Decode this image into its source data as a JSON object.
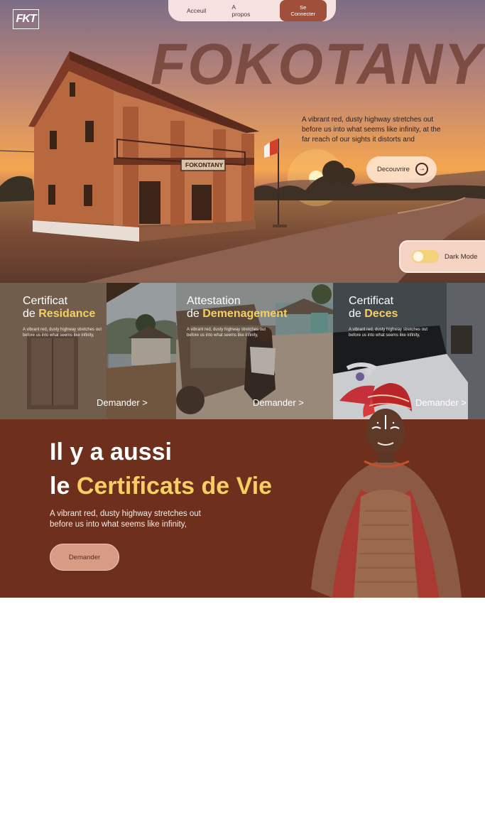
{
  "logo": {
    "text": "FKT"
  },
  "nav": {
    "links": [
      "Acceuil",
      "A propos"
    ],
    "login_label": "Se Connecter"
  },
  "hero": {
    "title": "FOKOTANY",
    "sign_text": "FOKONTANY",
    "description": "A vibrant red, dusty highway stretches out before us into what seems like infinity, at the far reach of our sights it distorts and",
    "cta_label": "Decouvrire",
    "cta_icon": "arrow-right-circle-icon"
  },
  "dark_mode": {
    "label": "Dark Mode",
    "enabled": false
  },
  "cards": [
    {
      "title_line1": "Certificat",
      "title_prefix": "de ",
      "title_highlight": "Residance",
      "description": "A vibrant red, dusty highway stretches out before us into what seems like infinity,",
      "link": "Demander >"
    },
    {
      "title_line1": "Attestation",
      "title_prefix": "de ",
      "title_highlight": "Demenagement",
      "description": "A vibrant red, dusty highway stretches out before us into what seems like infinity,",
      "link": "Demander >"
    },
    {
      "title_line1": "Certificat",
      "title_prefix": "de ",
      "title_highlight": "Deces",
      "description": "A vibrant red, dusty highway stretches out before us into what seems like infinity,",
      "link": "Demander >"
    }
  ],
  "vie": {
    "line1": "Il y a aussi",
    "line2_prefix": "le ",
    "line2_highlight": "Certificats de Vie",
    "description": "A vibrant red, dusty highway stretches out before us into what seems like infinity,",
    "button_label": "Demander"
  },
  "colors": {
    "accent_yellow": "#f6cf63",
    "brand_brown": "#6e2f1c",
    "button_brown": "#a0503a"
  }
}
